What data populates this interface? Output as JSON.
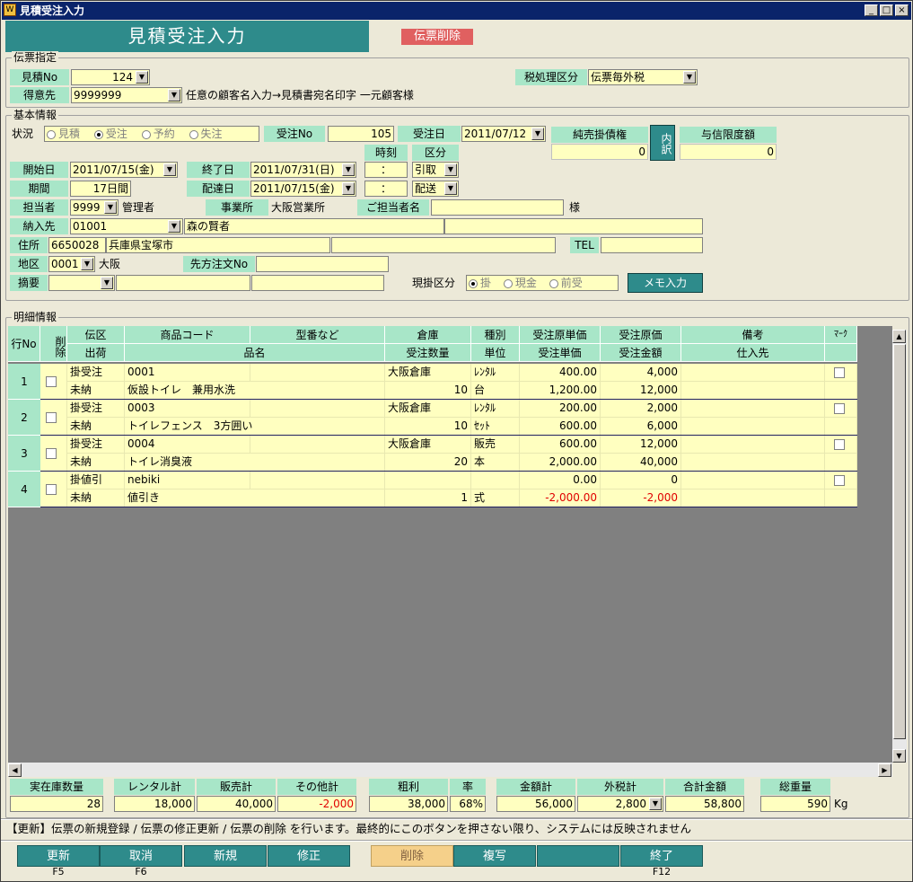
{
  "window": {
    "title": "見積受注入力",
    "icon": "app-icon",
    "controls": [
      "_",
      "□",
      "×"
    ]
  },
  "header": {
    "title": "見積受注入力",
    "delete_badge": "伝票削除"
  },
  "denpyo": {
    "group": "伝票指定",
    "mitsumori_no_label": "見積No",
    "mitsumori_no": "124",
    "tax_label": "税処理区分",
    "tax_value": "伝票毎外税",
    "tokui_label": "得意先",
    "tokui_value": "9999999",
    "tokui_note": "任意の顧客名入力→見積書宛名印字 一元顧客様"
  },
  "kihon": {
    "group": "基本情報",
    "status_label": "状況",
    "status_options": [
      "見積",
      "受注",
      "予約",
      "失注"
    ],
    "juchu_no_label": "受注No",
    "juchu_no": "105",
    "juchu_date_label": "受注日",
    "juchu_date": "2011/07/12",
    "junuri_label": "純売掛債権",
    "junuri_value": "0",
    "uchiwake": "内訳",
    "yoshin_label": "与信限度額",
    "yoshin_value": "0",
    "jikoku_label": "時刻",
    "kubun_label": "区分",
    "start_label": "開始日",
    "start_value": "2011/07/15(金)",
    "end_label": "終了日",
    "end_value": "2011/07/31(日)",
    "time1": "：",
    "kubun1": "引取",
    "period_label": "期間",
    "period_value": "17日間",
    "delivery_label": "配達日",
    "delivery_value": "2011/07/15(金)",
    "time2": "：",
    "kubun2": "配送",
    "tanto_label": "担当者",
    "tanto_code": "9999",
    "tanto_name": "管理者",
    "jigyo_label": "事業所",
    "jigyo_value": "大阪営業所",
    "gotanto_label": "ご担当者名",
    "sama": "様",
    "nonyu_label": "納入先",
    "nonyu_code": "01001",
    "nonyu_name": "森の賢者",
    "address_label": "住所",
    "zip": "6650028",
    "address": "兵庫県宝塚市",
    "tel_label": "TEL",
    "area_label": "地区",
    "area_code": "0001",
    "area_name": "大阪",
    "saki_label": "先方注文No",
    "tekiyo_label": "摘要",
    "genkake_label": "現掛区分",
    "genkake_options": [
      "掛",
      "現金",
      "前受"
    ],
    "memo_button": "メモ入力"
  },
  "meisai": {
    "group": "明細情報",
    "headers_top": [
      "伝区",
      "商品コード",
      "型番など",
      "倉庫",
      "種別",
      "受注原単価",
      "受注原価",
      "備考",
      "ﾏｰｸ"
    ],
    "headers_bottom": [
      "出荷",
      "品名",
      "受注数量",
      "単位",
      "受注単価",
      "受注金額",
      "仕入先"
    ],
    "row_no_label": "行No",
    "delete_col": "削除",
    "rows": [
      {
        "no": "1",
        "den": "掛受注",
        "code": "0001",
        "kata": "",
        "soko": "大阪倉庫",
        "shubetsu": "ﾚﾝﾀﾙ",
        "gentanka": "400.00",
        "genka": "4,000",
        "shukka": "未納",
        "hinmei": "仮設トイレ　兼用水洗",
        "suryo": "10",
        "tani": "台",
        "tanka": "1,200.00",
        "kingaku": "12,000",
        "neg": false
      },
      {
        "no": "2",
        "den": "掛受注",
        "code": "0003",
        "kata": "",
        "soko": "大阪倉庫",
        "shubetsu": "ﾚﾝﾀﾙ",
        "gentanka": "200.00",
        "genka": "2,000",
        "shukka": "未納",
        "hinmei": "トイレフェンス　3方囲い",
        "suryo": "10",
        "tani": "ｾｯﾄ",
        "tanka": "600.00",
        "kingaku": "6,000",
        "neg": false
      },
      {
        "no": "3",
        "den": "掛受注",
        "code": "0004",
        "kata": "",
        "soko": "大阪倉庫",
        "shubetsu": "販売",
        "gentanka": "600.00",
        "genka": "12,000",
        "shukka": "未納",
        "hinmei": "トイレ消臭液",
        "suryo": "20",
        "tani": "本",
        "tanka": "2,000.00",
        "kingaku": "40,000",
        "neg": false
      },
      {
        "no": "4",
        "den": "掛値引",
        "code": "nebiki",
        "kata": "",
        "soko": "",
        "shubetsu": "",
        "gentanka": "0.00",
        "genka": "0",
        "shukka": "未納",
        "hinmei": "値引き",
        "suryo": "1",
        "tani": "式",
        "tanka": "-2,000.00",
        "kingaku": "-2,000",
        "neg": true
      }
    ]
  },
  "totals": {
    "zaiko_label": "実在庫数量",
    "zaiko": "28",
    "rental_label": "レンタル計",
    "rental": "18,000",
    "hanbai_label": "販売計",
    "hanbai": "40,000",
    "other_label": "その他計",
    "other": "-2,000",
    "arari_label": "粗利",
    "arari": "38,000",
    "rate_label": "率",
    "rate": "68%",
    "kingaku_label": "金額計",
    "kingaku": "56,000",
    "tax_label": "外税計",
    "tax": "2,800",
    "total_label": "合計金額",
    "total": "58,800",
    "weight_label": "総重量",
    "weight": "590",
    "weight_unit": "Kg"
  },
  "status_message": "【更新】伝票の新規登録 / 伝票の修正更新 / 伝票の削除 を行います。最終的にこのボタンを押さない限り、システムには反映されません",
  "fbuttons": [
    {
      "label": "更新",
      "key": "F5"
    },
    {
      "label": "取消",
      "key": "F6"
    },
    {
      "label": "新規",
      "key": ""
    },
    {
      "label": "修正",
      "key": ""
    },
    {
      "label": "削除",
      "key": ""
    },
    {
      "label": "複写",
      "key": ""
    },
    {
      "label": "",
      "key": ""
    },
    {
      "label": "終了",
      "key": "F12"
    }
  ]
}
